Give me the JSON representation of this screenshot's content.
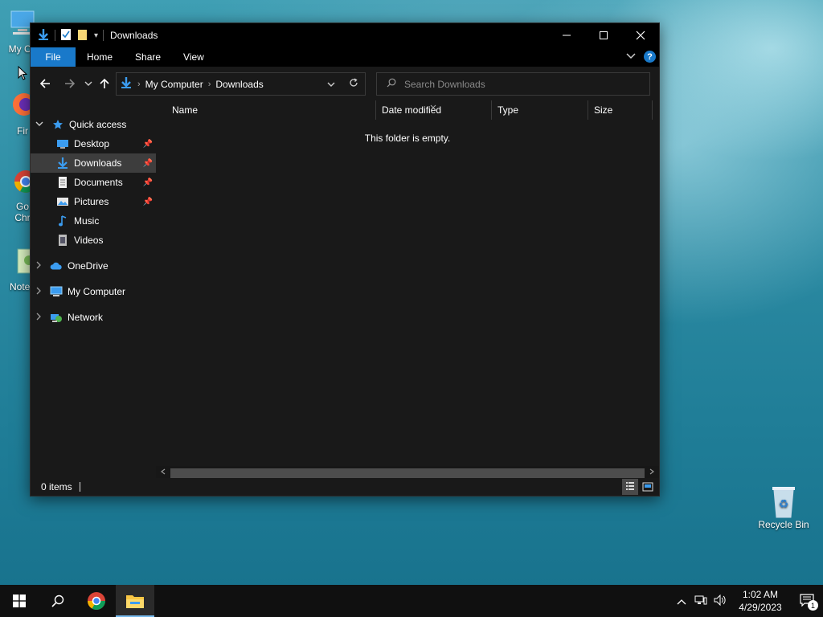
{
  "desktop": {
    "icons": [
      {
        "label": "My Co",
        "icon": "computer-icon"
      },
      {
        "label": "Fir",
        "icon": "firefox-icon"
      },
      {
        "label": "Go\nChr",
        "icon": "chrome-icon"
      },
      {
        "label": "Notep",
        "icon": "notepad-icon"
      },
      {
        "label": "Recycle Bin",
        "icon": "recycle-bin-icon"
      }
    ]
  },
  "window": {
    "title": "Downloads",
    "controls": {
      "minimize": "—",
      "maximize": "☐",
      "close": "✕"
    },
    "ribbon": {
      "tabs": [
        "File",
        "Home",
        "Share",
        "View"
      ],
      "help": "?"
    },
    "address": {
      "crumbs": [
        "My Computer",
        "Downloads"
      ]
    },
    "search": {
      "placeholder": "Search Downloads"
    },
    "navpane": {
      "quick_access": "Quick access",
      "items": [
        "Desktop",
        "Downloads",
        "Documents",
        "Pictures",
        "Music",
        "Videos"
      ],
      "onedrive": "OneDrive",
      "my_computer": "My Computer",
      "network": "Network"
    },
    "columns": [
      "Name",
      "Date modified",
      "Type",
      "Size"
    ],
    "empty_message": "This folder is empty.",
    "status": {
      "items": "0 items"
    }
  },
  "taskbar": {
    "clock": {
      "time": "1:02 AM",
      "date": "4/29/2023"
    },
    "notification_count": "1"
  },
  "colors": {
    "accent": "#1979ca",
    "window_bg": "#191919",
    "selected_nav": "#3d3d3d"
  }
}
